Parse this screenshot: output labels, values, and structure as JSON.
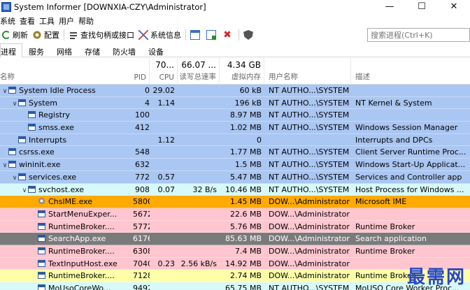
{
  "window": {
    "title": "System Informer [DOWNXIA-CZY\\Administrator]",
    "min_glyph": "—",
    "max_glyph": "☐",
    "close_glyph": "✕"
  },
  "menu": [
    "系统",
    "查看",
    "工具",
    "用户",
    "帮助"
  ],
  "toolbar": {
    "refresh_label": "刷新",
    "options_label": "配置",
    "find_label": "查找句柄或接口",
    "sysinfo_label": "系统信息"
  },
  "search": {
    "placeholder": "搜索进程(Ctrl+K)"
  },
  "tabs": [
    "进程",
    "服务",
    "网络",
    "存储",
    "防火墙",
    "设备"
  ],
  "columns": {
    "name": "名称",
    "pid": "PID",
    "cpu": "CPU",
    "io": "读写总速率",
    "mem": "虚拟内存",
    "user": "用户名称",
    "desc": "描述",
    "cpu_total": "70...",
    "io_total": "66.07 ...",
    "mem_total": "4.34 GB"
  },
  "rows": [
    {
      "name": "System Idle Process",
      "level": 0,
      "expander": "v",
      "icon": "window",
      "pid": "0",
      "cpu": "29.02",
      "io": "",
      "mem": "60 kB",
      "user": "NT AUTHO...\\SYSTEM",
      "desc": "",
      "color": "#aac6f2"
    },
    {
      "name": "System",
      "level": 1,
      "expander": "v",
      "icon": "window",
      "pid": "4",
      "cpu": "1.14",
      "io": "",
      "mem": "196 kB",
      "user": "NT AUTHO...\\SYSTEM",
      "desc": "NT Kernel & System",
      "color": "#aac6f2"
    },
    {
      "name": "Registry",
      "level": 2,
      "expander": "",
      "icon": "window",
      "pid": "100",
      "cpu": "",
      "io": "",
      "mem": "8.97 MB",
      "user": "NT AUTHO...\\SYSTEM",
      "desc": "",
      "color": "#aac6f2"
    },
    {
      "name": "smss.exe",
      "level": 2,
      "expander": "",
      "icon": "window",
      "pid": "412",
      "cpu": "",
      "io": "",
      "mem": "1.02 MB",
      "user": "NT AUTHO...\\SYSTEM",
      "desc": "Windows Session Manager",
      "color": "#aac6f2"
    },
    {
      "name": "Interrupts",
      "level": 1,
      "expander": "",
      "icon": "window",
      "pid": "",
      "cpu": "1.12",
      "io": "",
      "mem": "0",
      "user": "",
      "desc": "Interrupts and DPCs",
      "color": "#aac6f2"
    },
    {
      "name": "csrss.exe",
      "level": 0,
      "expander": "",
      "icon": "window",
      "pid": "548",
      "cpu": "",
      "io": "",
      "mem": "1.77 MB",
      "user": "NT AUTHO...\\SYSTEM",
      "desc": "Client Server Runtime Proc...",
      "color": "#aac6f2"
    },
    {
      "name": "wininit.exe",
      "level": 0,
      "expander": "v",
      "icon": "window",
      "pid": "632",
      "cpu": "",
      "io": "",
      "mem": "1.5 MB",
      "user": "NT AUTHO...\\SYSTEM",
      "desc": "Windows Start-Up Applicat...",
      "color": "#aac6f2"
    },
    {
      "name": "services.exe",
      "level": 1,
      "expander": "v",
      "icon": "window",
      "pid": "772",
      "cpu": "0.57",
      "io": "",
      "mem": "5.47 MB",
      "user": "NT AUTHO...\\SYSTEM",
      "desc": "Services and Controller app",
      "color": "#aac6f2"
    },
    {
      "name": "svchost.exe",
      "level": 2,
      "expander": "v",
      "icon": "window",
      "pid": "908",
      "cpu": "0.07",
      "io": "32 B/s",
      "mem": "10.46 MB",
      "user": "NT AUTHO...\\SYSTEM",
      "desc": "Host Process for Windows ...",
      "color": "#d7f9f9"
    },
    {
      "name": "ChsIME.exe",
      "level": 3,
      "expander": "",
      "icon": "gear",
      "pid": "5800",
      "cpu": "",
      "io": "",
      "mem": "1.45 MB",
      "user": "DOW...\\Administrator",
      "desc": "Microsoft IME",
      "color": "#ffaa00"
    },
    {
      "name": "StartMenuExper...",
      "level": 3,
      "expander": "",
      "icon": "window",
      "pid": "5672",
      "cpu": "",
      "io": "",
      "mem": "22.6 MB",
      "user": "DOW...\\Administrator",
      "desc": "",
      "color": "#ffc6d0"
    },
    {
      "name": "RuntimeBroker....",
      "level": 3,
      "expander": "",
      "icon": "window",
      "pid": "5772",
      "cpu": "",
      "io": "",
      "mem": "5.76 MB",
      "user": "DOW...\\Administrator",
      "desc": "Runtime Broker",
      "color": "#ffc6d0"
    },
    {
      "name": "SearchApp.exe",
      "level": 3,
      "expander": "",
      "icon": "window",
      "pid": "6176",
      "cpu": "",
      "io": "",
      "mem": "85.63 MB",
      "user": "DOW...\\Administrator",
      "desc": "Search application",
      "color": "#7a7a7a"
    },
    {
      "name": "RuntimeBroker....",
      "level": 3,
      "expander": "",
      "icon": "window",
      "pid": "6308",
      "cpu": "",
      "io": "",
      "mem": "7.4 MB",
      "user": "DOW...\\Administrator",
      "desc": "Runtime Broker",
      "color": "#ffc6d0"
    },
    {
      "name": "TextInputHost.exe",
      "level": 3,
      "expander": "",
      "icon": "window",
      "pid": "7040",
      "cpu": "0.23",
      "io": "2.56 kB/s",
      "mem": "14.92 MB",
      "user": "DOW...\\Administrator",
      "desc": "",
      "color": "#ffc6d0"
    },
    {
      "name": "RuntimeBroker....",
      "level": 3,
      "expander": "",
      "icon": "window",
      "pid": "7128",
      "cpu": "",
      "io": "",
      "mem": "2.74 MB",
      "user": "DOW...\\Administrator",
      "desc": "Runtime Broker",
      "color": "#ffffaa"
    },
    {
      "name": "MoUsoCoreWo...",
      "level": 3,
      "expander": "",
      "icon": "window",
      "pid": "9492",
      "cpu": "",
      "io": "",
      "mem": "65.75 MB",
      "user": "NT AUTHO...\\SYSTEM",
      "desc": "MoUSO Core Worker Proc...",
      "color": "#d7f9f9"
    }
  ],
  "watermark": "最需网"
}
